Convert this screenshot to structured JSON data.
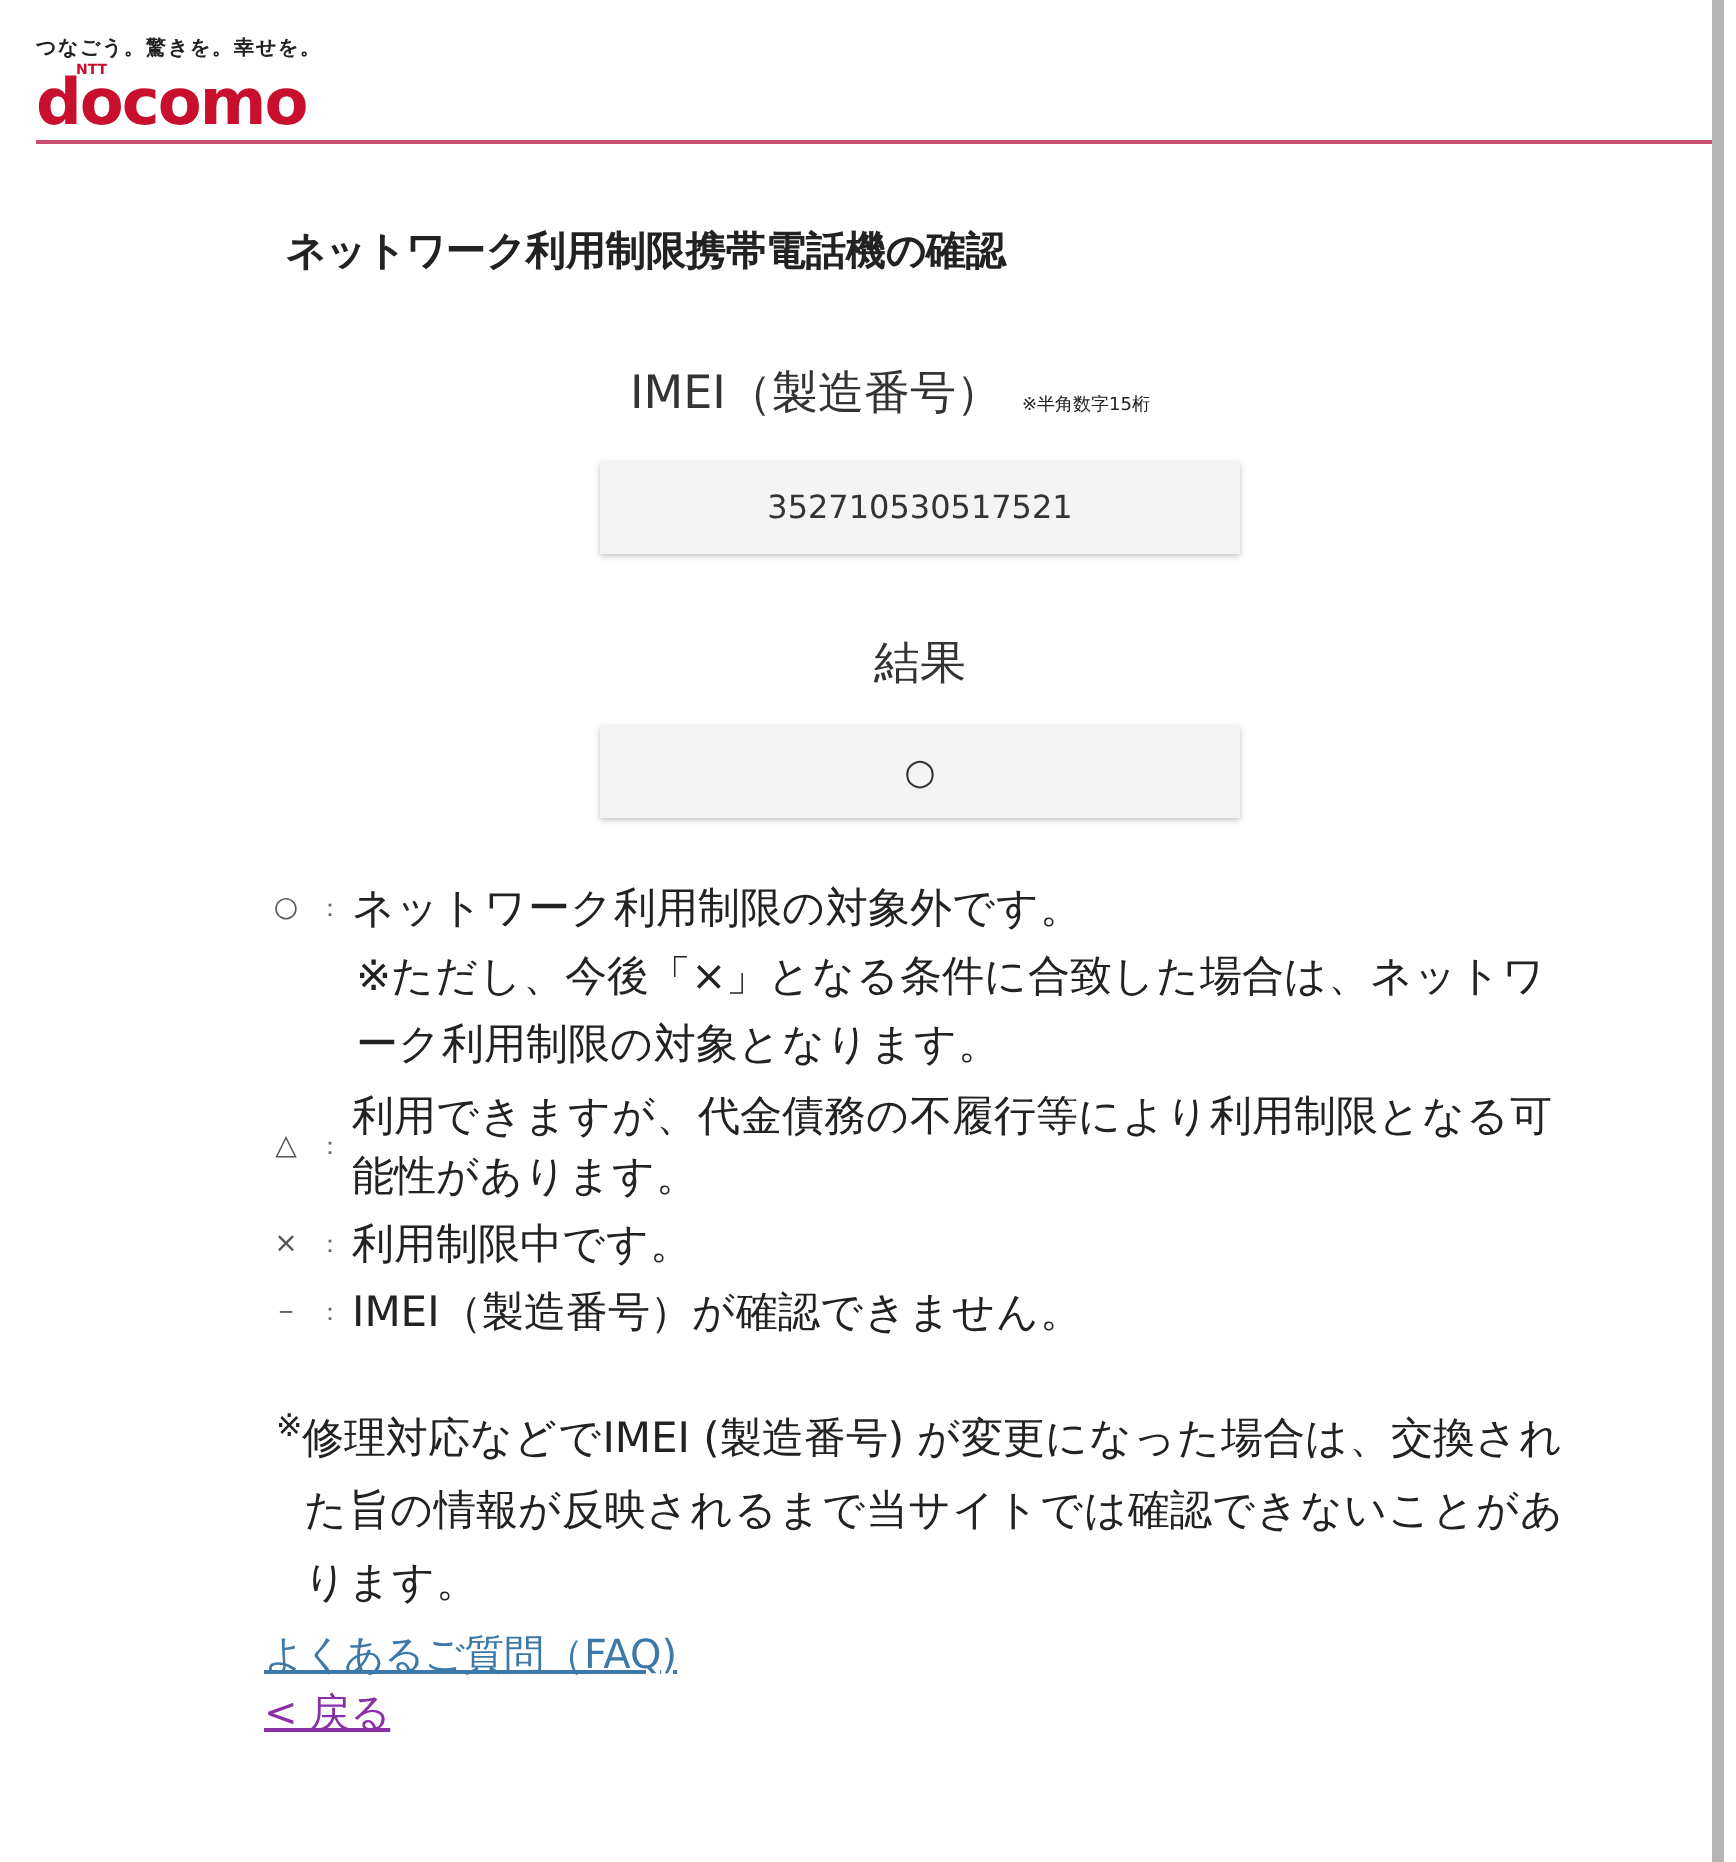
{
  "header": {
    "tagline": "つなごう。驚きを。幸せを。",
    "logo_small": "NTT",
    "logo": "docomo"
  },
  "title": "ネットワーク利用制限携帯電話機の確認",
  "imei": {
    "label": "IMEI（製造番号）",
    "note": "※半角数字15桁",
    "value": "352710530517521"
  },
  "result": {
    "label": "結果",
    "value": "○"
  },
  "legend": [
    {
      "symbol": "○",
      "sep": "：",
      "text": "ネットワーク利用制限の対象外です。",
      "note": "※ただし、今後「×」となる条件に合致した場合は、ネットワーク利用制限の対象となります。"
    },
    {
      "symbol": "△",
      "sep": "：",
      "text": "利用できますが、代金債務の不履行等により利用制限となる可能性があります。"
    },
    {
      "symbol": "×",
      "sep": "：",
      "text": "利用制限中です。"
    },
    {
      "symbol": "－",
      "sep": "：",
      "text": "IMEI（製造番号）が確認できません。"
    }
  ],
  "notice": "$^{※}$修理対応などでIMEI (製造番号) が変更になった場合は、交換された旨の情報が反映されるまで当サイトでは確認できないことがあります。",
  "links": [
    {
      "label": "よくあるご質問（FAQ)",
      "visited": false
    },
    {
      "label": "< 戻る",
      "visited": true
    }
  ]
}
